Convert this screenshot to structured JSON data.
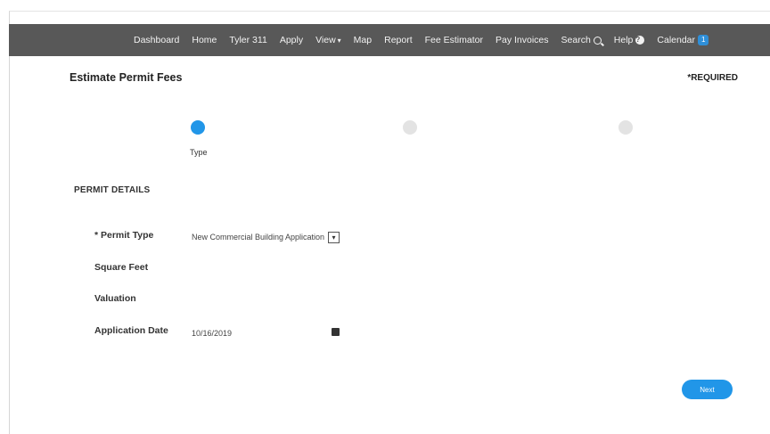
{
  "nav": {
    "items": [
      {
        "label": "Dashboard"
      },
      {
        "label": "Home"
      },
      {
        "label": "Tyler 311"
      },
      {
        "label": "Apply"
      },
      {
        "label": "View"
      },
      {
        "label": "Map"
      },
      {
        "label": "Report"
      },
      {
        "label": "Fee Estimator"
      },
      {
        "label": "Pay Invoices"
      },
      {
        "label": "Search"
      },
      {
        "label": "Help"
      },
      {
        "label": "Calendar"
      }
    ],
    "calendar_badge": "1"
  },
  "page": {
    "title": "Estimate Permit Fees",
    "required_note": "*REQUIRED"
  },
  "steps": {
    "active_label": "Type"
  },
  "section": {
    "title": "PERMIT DETAILS"
  },
  "form": {
    "permit_type": {
      "label": "* Permit Type",
      "value": "New Commercial Building Application"
    },
    "square_feet": {
      "label": "Square Feet",
      "value": ""
    },
    "valuation": {
      "label": "Valuation",
      "value": ""
    },
    "application_date": {
      "label": "Application Date",
      "value": "10/16/2019"
    }
  },
  "actions": {
    "next_label": "Next"
  },
  "colors": {
    "nav_bg": "#585858",
    "accent": "#2196e8",
    "step_inactive": "#e3e3e3"
  },
  "icons": [
    "caret-down-icon",
    "search-icon",
    "help-icon",
    "calendar-icon",
    "select-arrow-icon"
  ]
}
